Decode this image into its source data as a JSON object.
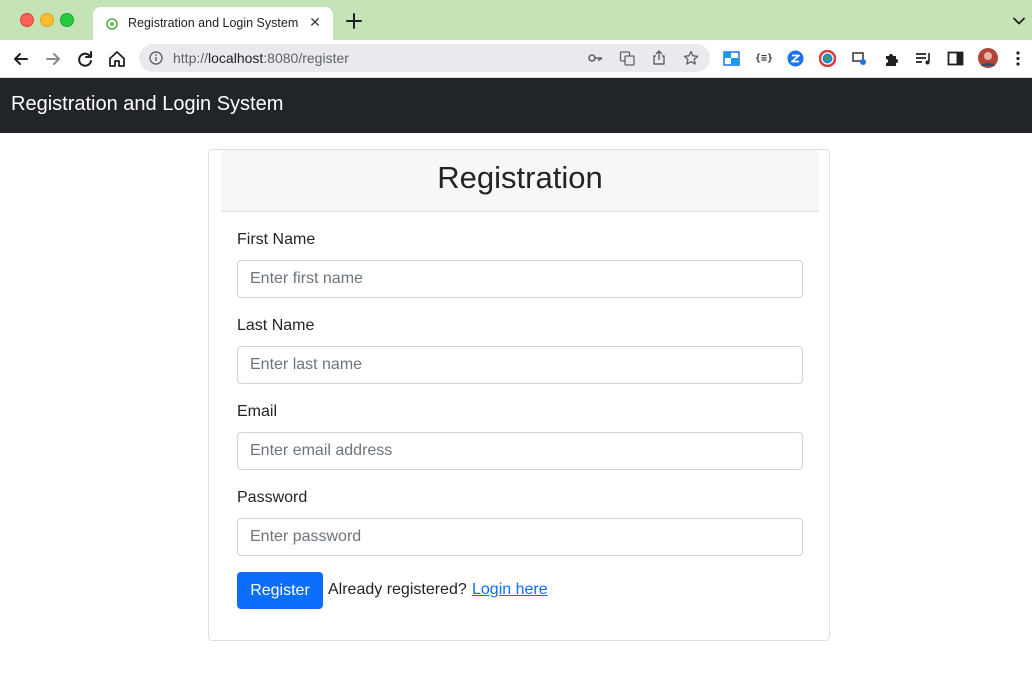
{
  "browser": {
    "tab_title": "Registration and Login System",
    "url_prefix": "http://",
    "url_host": "localhost",
    "url_rest": ":8080/register"
  },
  "navbar": {
    "brand": "Registration and Login System"
  },
  "form": {
    "title": "Registration",
    "fields": [
      {
        "label": "First Name",
        "placeholder": "Enter first name",
        "value": ""
      },
      {
        "label": "Last Name",
        "placeholder": "Enter last name",
        "value": ""
      },
      {
        "label": "Email",
        "placeholder": "Enter email address",
        "value": ""
      },
      {
        "label": "Password",
        "placeholder": "Enter password",
        "value": ""
      }
    ],
    "submit_label": "Register",
    "already_text": "Already registered?",
    "login_link": "Login here"
  },
  "colors": {
    "tabbar": "#c4e4b8",
    "navbar": "#212529",
    "primary": "#0d6efd"
  },
  "icons": [
    "globe-favicon-icon",
    "close-icon",
    "plus-icon",
    "chevron-down-icon",
    "back-arrow-icon",
    "forward-arrow-icon",
    "reload-icon",
    "home-icon",
    "info-icon",
    "key-icon",
    "translate-icon",
    "share-icon",
    "star-icon",
    "extension-icon",
    "puzzle-icon",
    "media-queue-icon",
    "side-panel-icon",
    "avatar"
  ]
}
